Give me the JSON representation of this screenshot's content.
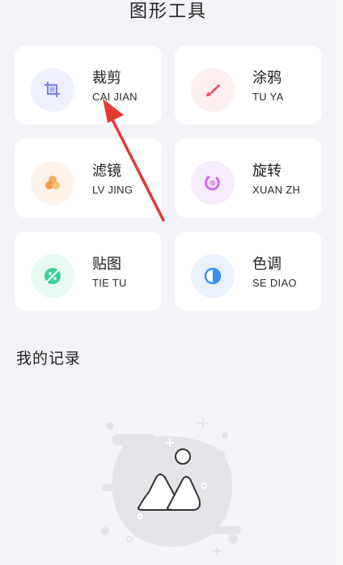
{
  "header": {
    "title": "图形工具"
  },
  "tools": [
    {
      "key": "crop",
      "title": "裁剪",
      "subtitle": "CAI JIAN",
      "icon": "crop-icon",
      "color": "#7a7ff0",
      "bg": "#eef0fd"
    },
    {
      "key": "doodle",
      "title": "涂鸦",
      "subtitle": "TU YA",
      "icon": "brush-icon",
      "color": "#f0506a",
      "bg": "#fdeef0"
    },
    {
      "key": "filter",
      "title": "滤镜",
      "subtitle": "LV JING",
      "icon": "filter-icon",
      "color": "#f6a04a",
      "bg": "#fdf3ea"
    },
    {
      "key": "rotate",
      "title": "旋转",
      "subtitle": "XUAN ZH",
      "icon": "rotate-icon",
      "color": "#d06ef0",
      "bg": "#f6ecfd"
    },
    {
      "key": "sticker",
      "title": "贴图",
      "subtitle": "TIE TU",
      "icon": "sticker-icon",
      "color": "#3dd196",
      "bg": "#e8f9f1"
    },
    {
      "key": "tone",
      "title": "色调",
      "subtitle": "SE DIAO",
      "icon": "tone-icon",
      "color": "#3a8ef0",
      "bg": "#eaf2fd"
    }
  ],
  "records": {
    "title": "我的记录"
  },
  "colors": {
    "background": "#f3f4f8",
    "card": "#ffffff",
    "annotation_arrow": "#e53935"
  }
}
